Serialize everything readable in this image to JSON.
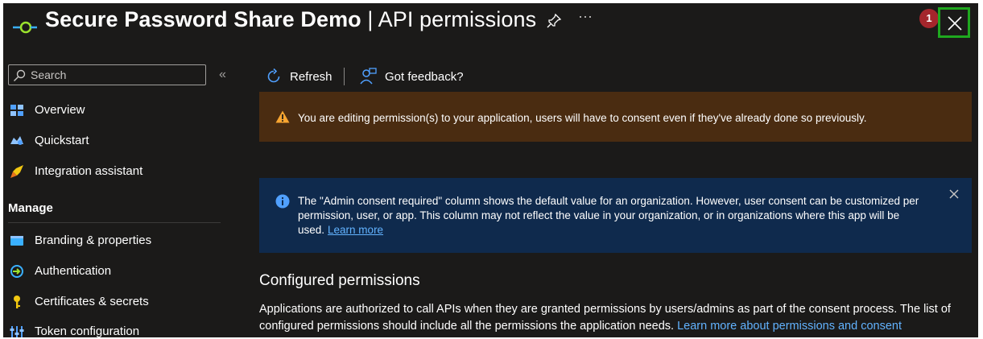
{
  "header": {
    "title_bold": "Secure Password Share Demo",
    "title_rest": " | API permissions",
    "more_label": "···",
    "notification_count": "1"
  },
  "sidebar": {
    "search_placeholder": "Search",
    "collapse_label": "«",
    "items": [
      {
        "label": "Overview",
        "icon": "overview-icon"
      },
      {
        "label": "Quickstart",
        "icon": "quickstart-icon"
      },
      {
        "label": "Integration assistant",
        "icon": "rocket-icon"
      }
    ],
    "section_title": "Manage",
    "manage_items": [
      {
        "label": "Branding & properties",
        "icon": "branding-icon"
      },
      {
        "label": "Authentication",
        "icon": "authentication-icon"
      },
      {
        "label": "Certificates & secrets",
        "icon": "key-icon"
      },
      {
        "label": "Token configuration",
        "icon": "token-icon"
      }
    ]
  },
  "toolbar": {
    "refresh_label": "Refresh",
    "feedback_label": "Got feedback?"
  },
  "warning_banner": {
    "text": "You are editing permission(s) to your application, users will have to consent even if they've already done so previously."
  },
  "info_banner": {
    "text": "The \"Admin consent required\" column shows the default value for an organization. However, user consent can be customized per permission, user, or app. This column may not reflect the value in your organization, or in organizations where this app will be used.",
    "link": "Learn more"
  },
  "configured": {
    "title": "Configured permissions",
    "description": "Applications are authorized to call APIs when they are granted permissions by users/admins as part of the consent process. The list of configured permissions should include all the permissions the application needs.",
    "link": "Learn more about permissions and consent"
  },
  "colors": {
    "background": "#1b1a19",
    "warning_bg": "#4a2c11",
    "info_bg": "#0f2a4d",
    "link": "#62b3ff",
    "highlight": "#1fa81f",
    "badge": "#a4262c"
  }
}
